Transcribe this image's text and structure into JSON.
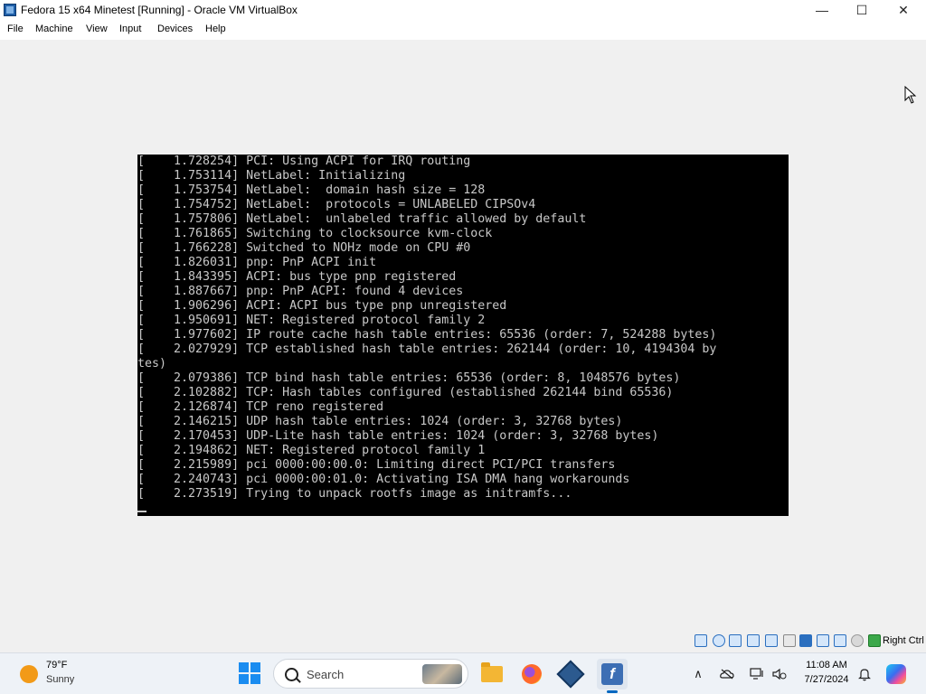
{
  "window": {
    "title": "Fedora 15 x64 Minetest [Running] - Oracle VM VirtualBox",
    "controls": {
      "minimize": "—",
      "maximize": "☐",
      "close": "✕"
    },
    "app_icon": "virtualbox-icon"
  },
  "menu": {
    "file": "File",
    "machine": "Machine",
    "view": "View",
    "input": "Input",
    "devices": "Devices",
    "help": "Help"
  },
  "console": {
    "lines": [
      "[    1.728254] PCI: Using ACPI for IRQ routing",
      "[    1.753114] NetLabel: Initializing",
      "[    1.753754] NetLabel:  domain hash size = 128",
      "[    1.754752] NetLabel:  protocols = UNLABELED CIPSOv4",
      "[    1.757806] NetLabel:  unlabeled traffic allowed by default",
      "[    1.761865] Switching to clocksource kvm-clock",
      "[    1.766228] Switched to NOHz mode on CPU #0",
      "[    1.826031] pnp: PnP ACPI init",
      "[    1.843395] ACPI: bus type pnp registered",
      "[    1.887667] pnp: PnP ACPI: found 4 devices",
      "[    1.906296] ACPI: ACPI bus type pnp unregistered",
      "[    1.950691] NET: Registered protocol family 2",
      "[    1.977602] IP route cache hash table entries: 65536 (order: 7, 524288 bytes)",
      "[    2.027929] TCP established hash table entries: 262144 (order: 10, 4194304 by",
      "tes)",
      "[    2.079386] TCP bind hash table entries: 65536 (order: 8, 1048576 bytes)",
      "[    2.102882] TCP: Hash tables configured (established 262144 bind 65536)",
      "[    2.126874] TCP reno registered",
      "[    2.146215] UDP hash table entries: 1024 (order: 3, 32768 bytes)",
      "[    2.170453] UDP-Lite hash table entries: 1024 (order: 3, 32768 bytes)",
      "[    2.194862] NET: Registered protocol family 1",
      "[    2.215989] pci 0000:00:00.0: Limiting direct PCI/PCI transfers",
      "[    2.240743] pci 0000:00:01.0: Activating ISA DMA hang workarounds",
      "[    2.273519] Trying to unpack rootfs image as initramfs..."
    ]
  },
  "status_bar": {
    "icons": [
      "optical-drive-icon",
      "audio-icon",
      "network-icon",
      "usb-icon",
      "shared-folders-icon",
      "display-icon",
      "video-capture-icon",
      "virtualization-icon",
      "mouse-integration-icon",
      "host-key-icon"
    ],
    "host_key": "Right Ctrl"
  },
  "taskbar": {
    "weather": {
      "temp": "79°F",
      "condition": "Sunny"
    },
    "search_placeholder": "Search",
    "apps": [
      "file-explorer-icon",
      "firefox-icon",
      "virtualbox-icon",
      "fedora-vm-icon"
    ],
    "tray": {
      "chevron": "∧",
      "time": "11:08 AM",
      "date": "7/27/2024"
    }
  }
}
